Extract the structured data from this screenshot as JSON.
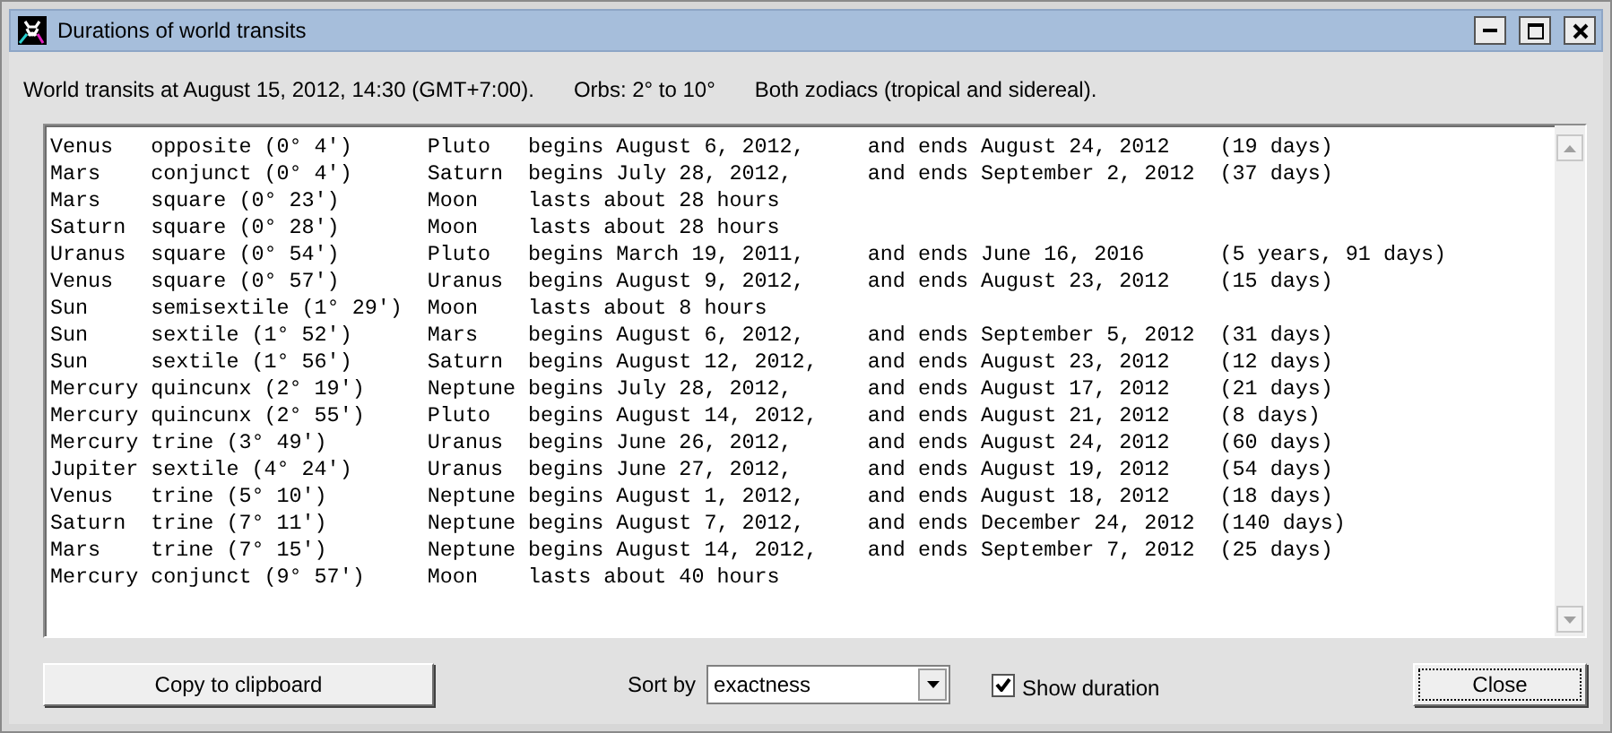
{
  "window": {
    "title": "Durations of world transits"
  },
  "header": [
    {
      "text": "World transits at August 15, 2012, 14:30 (GMT+7:00)."
    },
    {
      "text": "Orbs: 2° to 10°"
    },
    {
      "text": "Both zodiacs (tropical and sidereal)."
    }
  ],
  "lines": [
    "Venus   opposite (0° 4')      Pluto   begins August 6, 2012,     and ends August 24, 2012    (19 days)",
    "Mars    conjunct (0° 4')      Saturn  begins July 28, 2012,      and ends September 2, 2012  (37 days)",
    "Mars    square (0° 23')       Moon    lasts about 28 hours",
    "Saturn  square (0° 28')       Moon    lasts about 28 hours",
    "Uranus  square (0° 54')       Pluto   begins March 19, 2011,     and ends June 16, 2016      (5 years, 91 days)",
    "Venus   square (0° 57')       Uranus  begins August 9, 2012,     and ends August 23, 2012    (15 days)",
    "Sun     semisextile (1° 29')  Moon    lasts about 8 hours",
    "Sun     sextile (1° 52')      Mars    begins August 6, 2012,     and ends September 5, 2012  (31 days)",
    "Sun     sextile (1° 56')      Saturn  begins August 12, 2012,    and ends August 23, 2012    (12 days)",
    "Mercury quincunx (2° 19')     Neptune begins July 28, 2012,      and ends August 17, 2012    (21 days)",
    "Mercury quincunx (2° 55')     Pluto   begins August 14, 2012,    and ends August 21, 2012    (8 days)",
    "Mercury trine (3° 49')        Uranus  begins June 26, 2012,      and ends August 24, 2012    (60 days)",
    "Jupiter sextile (4° 24')      Uranus  begins June 27, 2012,      and ends August 19, 2012    (54 days)",
    "Venus   trine (5° 10')        Neptune begins August 1, 2012,     and ends August 18, 2012    (18 days)",
    "Saturn  trine (7° 11')        Neptune begins August 7, 2012,     and ends December 24, 2012  (140 days)",
    "Mars    trine (7° 15')        Neptune begins August 14, 2012,    and ends September 7, 2012  (25 days)",
    "Mercury conjunct (9° 57')     Moon    lasts about 40 hours"
  ],
  "footer": {
    "copy_button": "Copy to clipboard",
    "sort_label": "Sort by",
    "sort_value": "exactness",
    "show_duration": {
      "label": "Show duration",
      "checked": true
    },
    "close_button": "Close"
  }
}
